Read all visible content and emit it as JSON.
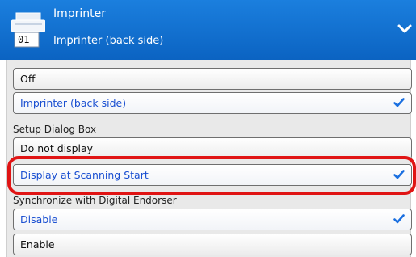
{
  "header": {
    "title": "Imprinter",
    "subtitle": "Imprinter (back side)",
    "icon_number": "01",
    "icon": "printer-icon",
    "expand_icon": "chevron-down-icon",
    "accent_color": "#1b7fde"
  },
  "imprinter_options": [
    {
      "label": "Off",
      "selected": false
    },
    {
      "label": "Imprinter (back side)",
      "selected": true
    }
  ],
  "setup_dialog_box": {
    "label": "Setup Dialog Box",
    "options": [
      {
        "label": "Do not display",
        "selected": false
      },
      {
        "label": "Display at Scanning Start",
        "selected": true
      }
    ]
  },
  "sync_digital_endorser": {
    "label": "Synchronize with Digital Endorser",
    "options": [
      {
        "label": "Disable",
        "selected": true
      },
      {
        "label": "Enable",
        "selected": false
      }
    ]
  },
  "colors": {
    "selected_text": "#1a4fd1",
    "check": "#1a6fe0",
    "highlight": "#e01414"
  }
}
